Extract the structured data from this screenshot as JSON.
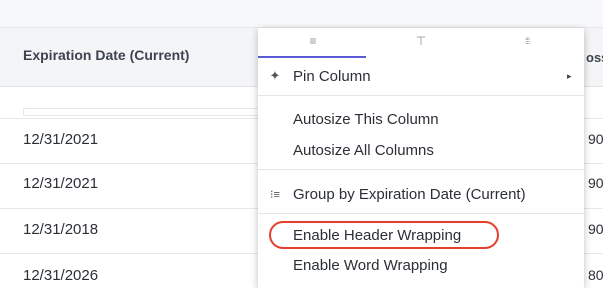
{
  "grid": {
    "column_header": "Expiration Date (Current)",
    "edge_header": "oss",
    "rows": [
      {
        "date": "12/31/2021",
        "edge": "90"
      },
      {
        "date": "12/31/2021",
        "edge": "90"
      },
      {
        "date": "12/31/2018",
        "edge": "90"
      },
      {
        "date": "12/31/2026",
        "edge": "80"
      }
    ]
  },
  "menu": {
    "tabs": [
      {
        "name": "general",
        "glyph": "≡"
      },
      {
        "name": "filter",
        "glyph": "⊤"
      },
      {
        "name": "columns",
        "glyph": "⁞⁞⁞"
      }
    ],
    "items": [
      {
        "label": "Pin Column",
        "icon": "pin-icon",
        "glyph": "✦",
        "submenu_arrow": "▸"
      },
      {
        "label": "Autosize This Column"
      },
      {
        "label": "Autosize All Columns"
      },
      {
        "label": "Group by Expiration Date (Current)",
        "icon": "group-icon",
        "glyph": "⁝≡"
      },
      {
        "label": "Enable Header Wrapping"
      },
      {
        "label": "Enable Word Wrapping"
      }
    ]
  },
  "colors": {
    "highlight": "#e43f2e",
    "active_tab": "#5b5bd6"
  }
}
